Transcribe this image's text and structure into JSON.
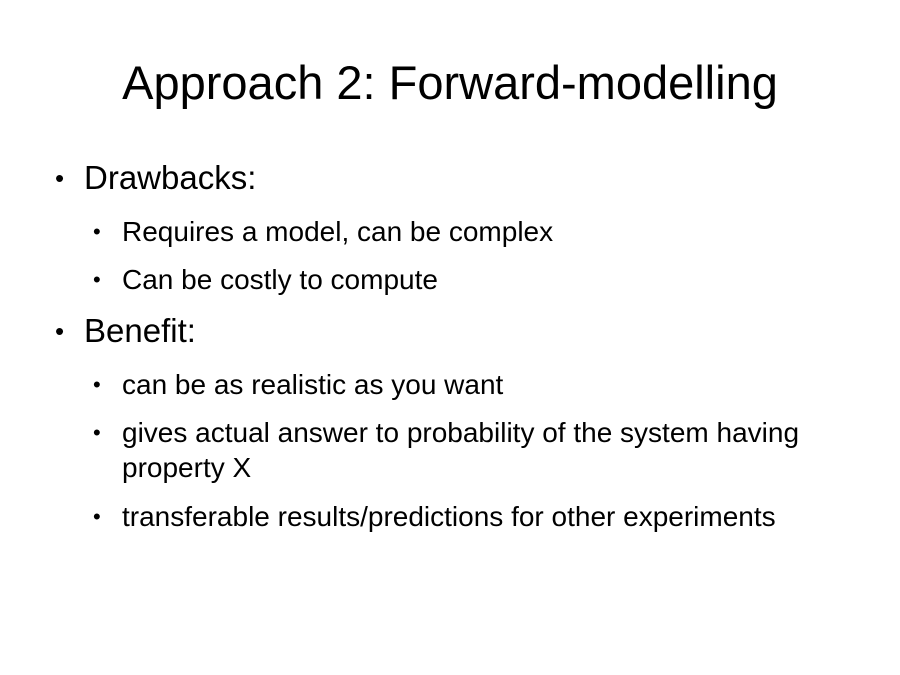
{
  "slide": {
    "title": "Approach 2: Forward-modelling",
    "bullet_glyph": "•",
    "sections": [
      {
        "heading": "Drawbacks:",
        "items": [
          "Requires a model, can be complex",
          "Can be costly to compute"
        ]
      },
      {
        "heading": "Benefit:",
        "items": [
          "can be as realistic as you want",
          "gives actual answer to probability of the system having property X",
          "transferable results/predictions for other experiments"
        ]
      }
    ]
  }
}
